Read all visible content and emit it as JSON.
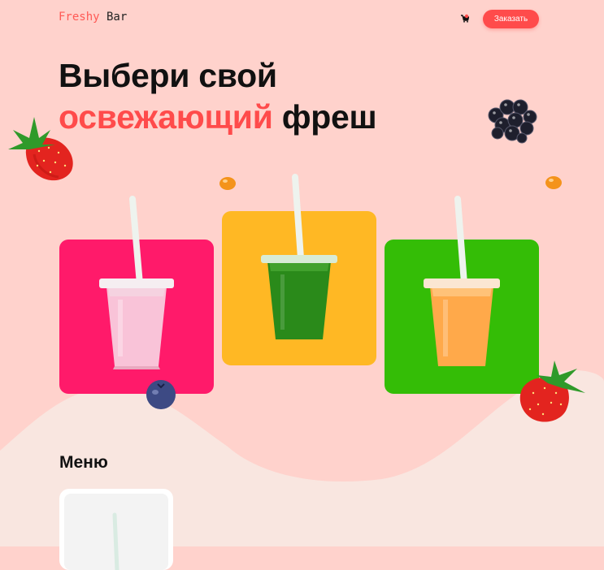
{
  "header": {
    "logo_part1": "Freshy",
    "logo_part2": " Bar",
    "cart_icon": "cart-icon",
    "order_button": "Заказать"
  },
  "hero": {
    "line1": "Выбери свой",
    "accent": "освежающий",
    "line2_rest": " фреш"
  },
  "products": [
    {
      "name": "berry-smoothie",
      "card_color": "#ff1a6a",
      "drink_color": "#f9c3d8"
    },
    {
      "name": "green-smoothie",
      "card_color": "#ffb824",
      "drink_color": "#2a8a1a"
    },
    {
      "name": "orange-smoothie",
      "card_color": "#34bd06",
      "drink_color": "#ffa94a"
    }
  ],
  "menu": {
    "title": "Меню"
  },
  "colors": {
    "background": "#ffd2cc",
    "accent": "#ff4b4b",
    "wave": "#f9e6e0"
  }
}
